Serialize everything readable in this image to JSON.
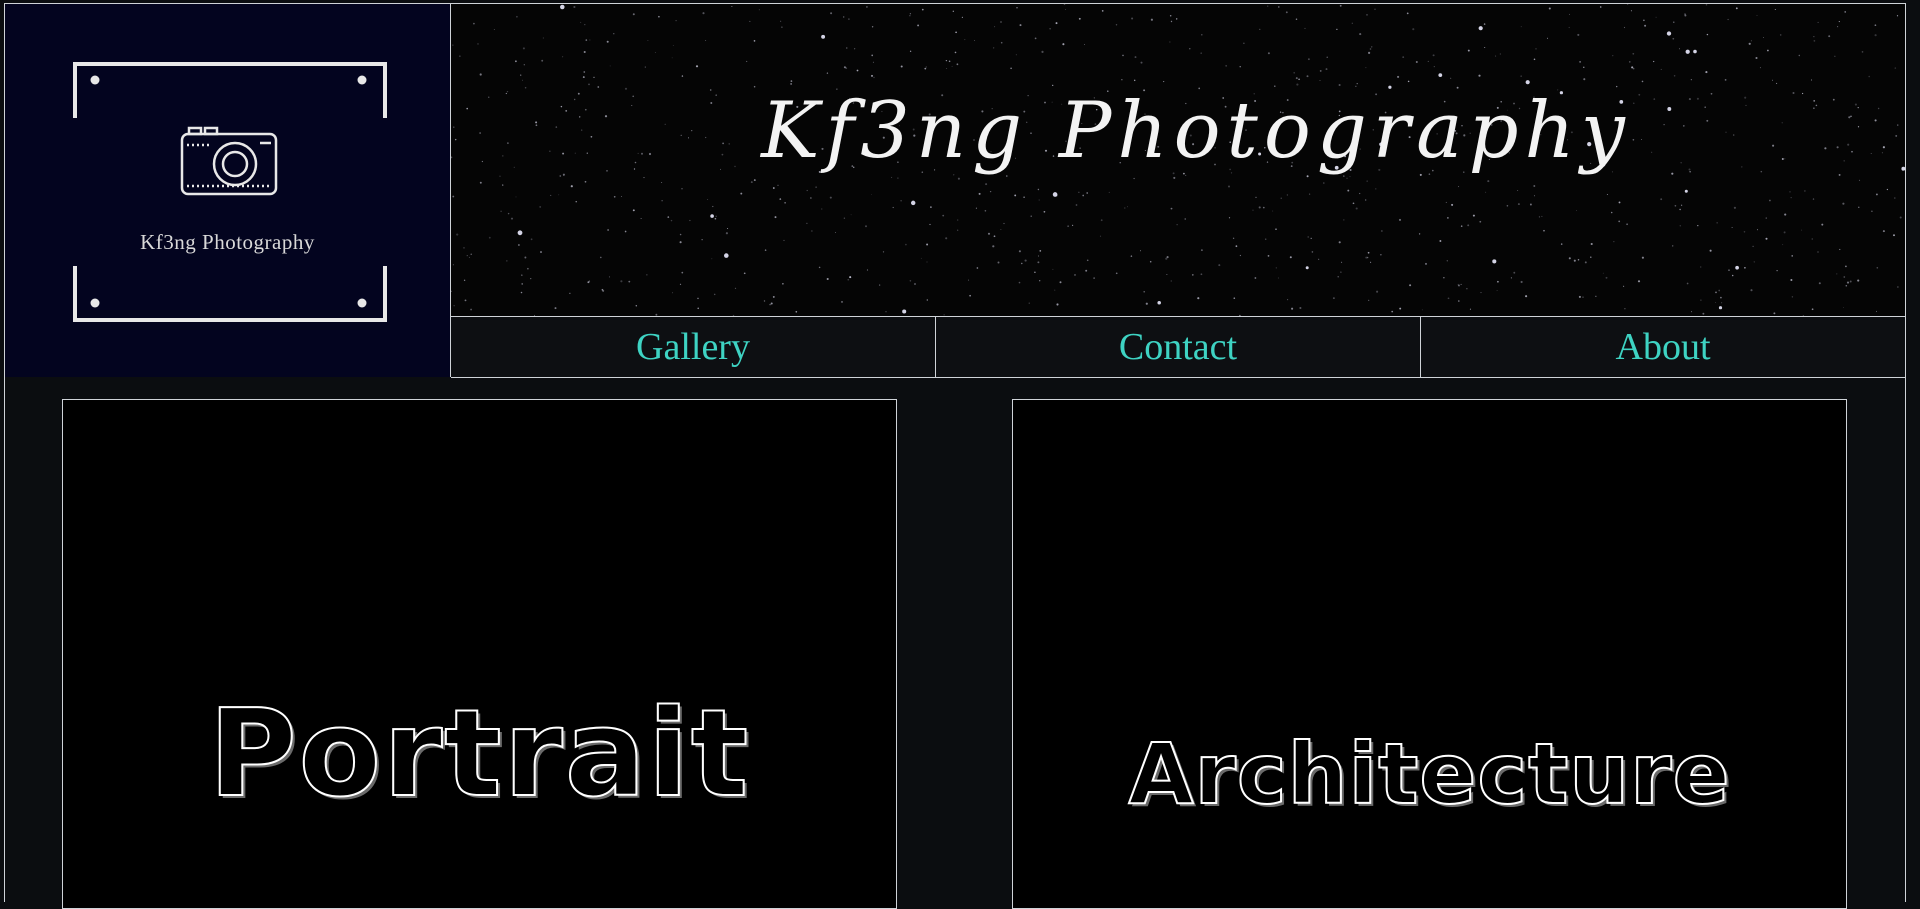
{
  "logo": {
    "text": "Kf3ng Photography",
    "icon": "camera-icon",
    "background": "#03041f"
  },
  "banner": {
    "title": "Kf3ng Photography",
    "background": "starfield"
  },
  "nav": {
    "items": [
      {
        "label": "Gallery"
      },
      {
        "label": "Contact"
      },
      {
        "label": "About"
      }
    ],
    "color": "#3ed3c3"
  },
  "gallery": {
    "cards": [
      {
        "label": "Portrait"
      },
      {
        "label": "Architecture"
      }
    ]
  }
}
